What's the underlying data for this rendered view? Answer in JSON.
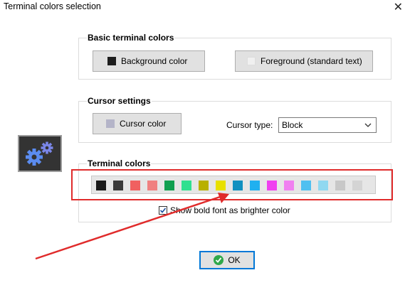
{
  "window": {
    "title": "Terminal colors selection"
  },
  "basic": {
    "title": "Basic terminal colors",
    "background_label": "Background color",
    "foreground_label": "Foreground (standard text)",
    "background_swatch": "#1e1e1e",
    "foreground_swatch": "#f0f0f0"
  },
  "cursor": {
    "title": "Cursor settings",
    "color_label": "Cursor color",
    "color_swatch": "#b4b4c8",
    "type_label": "Cursor type:",
    "type_value": "Block"
  },
  "terminal": {
    "title": "Terminal colors",
    "palette": [
      "#1a1a1a",
      "#3a3a3a",
      "#f06060",
      "#f08080",
      "#10a050",
      "#30e090",
      "#b8b000",
      "#e8e000",
      "#1090c0",
      "#20b0f0",
      "#f040f0",
      "#f080f0",
      "#50c0f0",
      "#90d8f0",
      "#c8c8c8",
      "#d4d4d4"
    ],
    "bold_label": "Show bold font as brighter color",
    "bold_checked": true
  },
  "ok_label": "OK",
  "colors": {
    "annotation": "#e02b2b",
    "focus_border": "#0078d7",
    "gear_icon": "#5b8cf0"
  }
}
